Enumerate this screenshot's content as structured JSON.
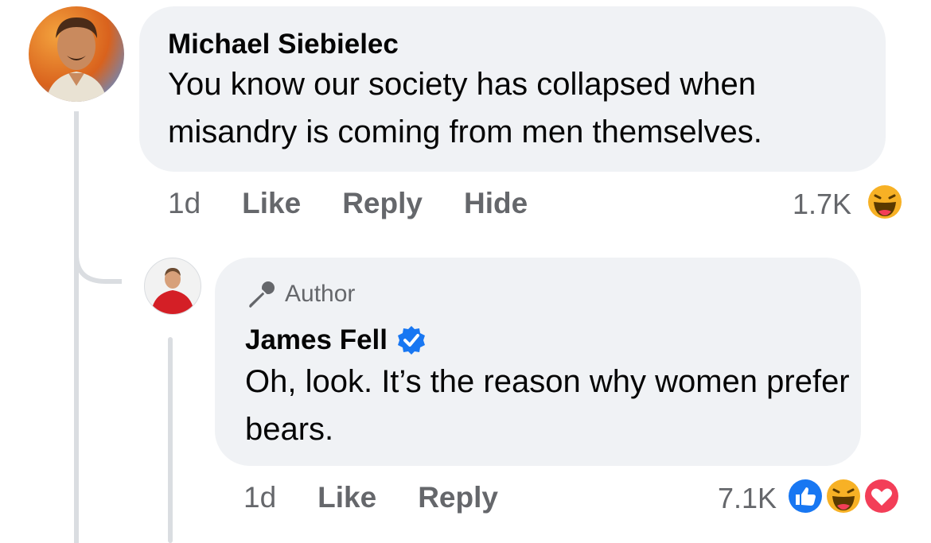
{
  "comment": {
    "author": "Michael Siebielec",
    "text": "You know our society has collapsed when misandry is coming from men themselves.",
    "time": "1d",
    "actions": {
      "like": "Like",
      "reply": "Reply",
      "hide": "Hide"
    },
    "reaction_count": "1.7K",
    "reactions": [
      "haha-icon"
    ]
  },
  "reply": {
    "badge": "Author",
    "author": "James Fell",
    "verified": true,
    "text": "Oh, look. It’s the reason why women prefer bears.",
    "time": "1d",
    "actions": {
      "like": "Like",
      "reply": "Reply"
    },
    "reaction_count": "7.1K",
    "reactions": [
      "like-icon",
      "haha-icon",
      "love-icon"
    ]
  },
  "colors": {
    "bubble": "#f0f2f5",
    "meta": "#65676b",
    "like": "#1877f2",
    "love": "#f33e58",
    "haha": "#f7b125",
    "verified": "#1877f2"
  }
}
